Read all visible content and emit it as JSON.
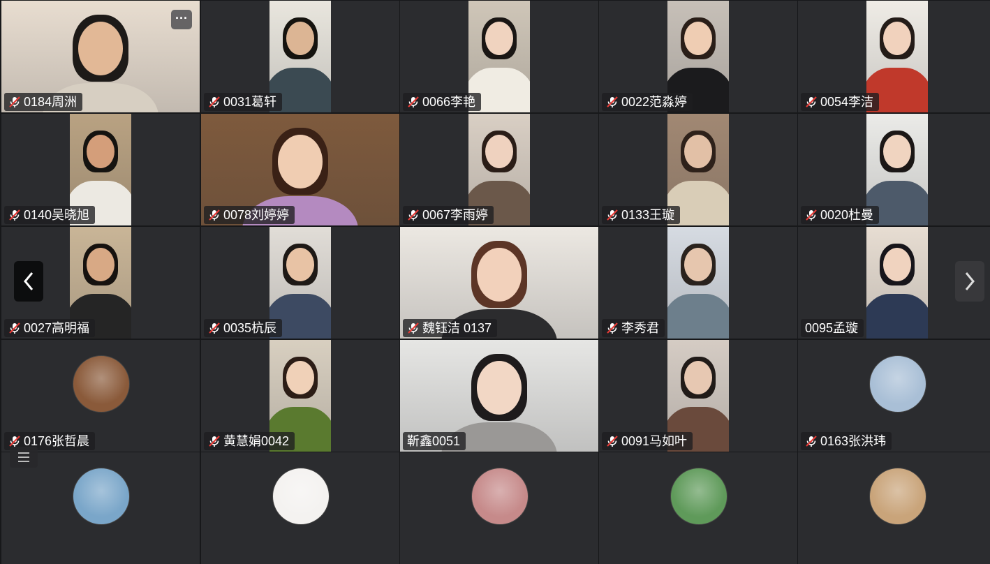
{
  "participants": [
    {
      "name": "0184周洲",
      "muted": true,
      "type": "video-full",
      "bg": "#e8ddd0",
      "skin": "#e2b896",
      "hair": "#1d1a18",
      "shirt": "#d7cfc2"
    },
    {
      "name": "0031葛轩",
      "muted": true,
      "type": "video-narrow",
      "bg": "#e9e6de",
      "skin": "#dcb594",
      "hair": "#15130f",
      "shirt": "#3b4a52"
    },
    {
      "name": "0066李艳",
      "muted": true,
      "type": "video-narrow",
      "bg": "#cfc6b8",
      "skin": "#f0d3bf",
      "hair": "#1a1614",
      "shirt": "#f0ece3"
    },
    {
      "name": "0022范淼婷",
      "muted": true,
      "type": "video-narrow",
      "bg": "#c7c0b8",
      "skin": "#efcdb3",
      "hair": "#2a1e18",
      "shirt": "#1b1b1d"
    },
    {
      "name": "0054李洁",
      "muted": true,
      "type": "video-narrow",
      "bg": "#efece6",
      "skin": "#f1d2bd",
      "hair": "#241c18",
      "shirt": "#c0392b"
    },
    {
      "name": "0140吴晓旭",
      "muted": true,
      "type": "video-narrow",
      "bg": "#b9a282",
      "skin": "#d49e7a",
      "hair": "#151310",
      "shirt": "#ece9e2"
    },
    {
      "name": "0078刘婷婷",
      "muted": true,
      "type": "video-full",
      "bg": "#7e5a3d",
      "skin": "#f0cdb2",
      "hair": "#3a2116",
      "shirt": "#b48ac0"
    },
    {
      "name": "0067李雨婷",
      "muted": true,
      "type": "video-narrow",
      "bg": "#d9cfc4",
      "skin": "#efd2bf",
      "hair": "#2a1d17",
      "shirt": "#6b584a"
    },
    {
      "name": "0133王璇",
      "muted": true,
      "type": "video-narrow",
      "bg": "#a18873",
      "skin": "#e2c0a6",
      "hair": "#2e211a",
      "shirt": "#d9cdb7"
    },
    {
      "name": "0020杜曼",
      "muted": true,
      "type": "video-narrow",
      "bg": "#ebebe8",
      "skin": "#f0d4c0",
      "hair": "#1b1716",
      "shirt": "#4d5a6a"
    },
    {
      "name": "0027高明福",
      "muted": true,
      "type": "video-narrow",
      "bg": "#c9b597",
      "skin": "#d8a985",
      "hair": "#16120f",
      "shirt": "#252525"
    },
    {
      "name": "0035杭辰",
      "muted": true,
      "type": "video-narrow",
      "bg": "#e1ddd7",
      "skin": "#e8c3a5",
      "hair": "#1e1916",
      "shirt": "#3d4a62"
    },
    {
      "name": "魏钰洁 0137",
      "muted": true,
      "type": "video-full",
      "bg": "#ece8e2",
      "skin": "#f2d1bb",
      "hair": "#5c3526",
      "shirt": "#2c2c2e"
    },
    {
      "name": "李秀君",
      "muted": true,
      "type": "video-narrow",
      "bg": "#d6dbe2",
      "skin": "#e6c6ae",
      "hair": "#2a221d",
      "shirt": "#6d7f8c"
    },
    {
      "name": "0095孟璇",
      "muted": false,
      "type": "video-narrow",
      "bg": "#e7ddd2",
      "skin": "#f0d3bf",
      "hair": "#17151a",
      "shirt": "#2d3a55"
    },
    {
      "name": "0176张哲晨",
      "muted": true,
      "type": "avatar",
      "bg": "#8a5a3a"
    },
    {
      "name": "黄慧娟0042",
      "muted": true,
      "type": "video-narrow",
      "bg": "#d8cfc0",
      "skin": "#f0d1b8",
      "hair": "#2c1d16",
      "shirt": "#5a7a2f"
    },
    {
      "name": "靳鑫0051",
      "muted": false,
      "type": "video-full",
      "bg": "#e6e6e4",
      "skin": "#f2d7c5",
      "hair": "#1e1b1c",
      "shirt": "#9a9896"
    },
    {
      "name": "0091马如叶",
      "muted": true,
      "type": "video-narrow",
      "bg": "#d5ccc4",
      "skin": "#e7c8b2",
      "hair": "#211b18",
      "shirt": "#6a4a3c"
    },
    {
      "name": "0163张洪玮",
      "muted": true,
      "type": "avatar",
      "bg": "#a9bfd6"
    },
    {
      "name": "",
      "muted": false,
      "type": "avatar",
      "bg": "#7aa6c9"
    },
    {
      "name": "",
      "muted": false,
      "type": "avatar",
      "bg": "#f4f2f0"
    },
    {
      "name": "",
      "muted": false,
      "type": "avatar",
      "bg": "#c68a8a"
    },
    {
      "name": "",
      "muted": false,
      "type": "avatar",
      "bg": "#5f9a5a"
    },
    {
      "name": "",
      "muted": false,
      "type": "avatar",
      "bg": "#c9a47a"
    }
  ],
  "controls": {
    "more_label": "···",
    "prev_icon": "chevron-left-icon",
    "next_icon": "chevron-right-icon",
    "list_icon": "list-icon"
  }
}
